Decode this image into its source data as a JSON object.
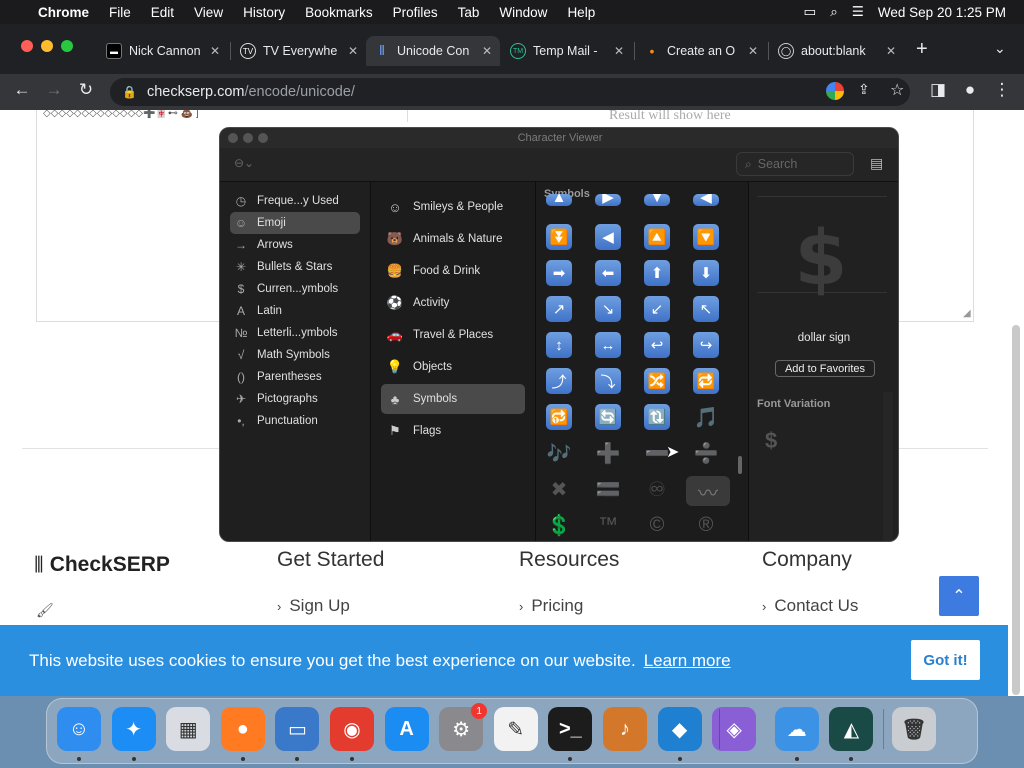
{
  "menubar": {
    "app": "Chrome",
    "items": [
      "File",
      "Edit",
      "View",
      "History",
      "Bookmarks",
      "Profiles",
      "Tab",
      "Window",
      "Help"
    ],
    "datetime": "Wed Sep 20  1:25 PM"
  },
  "tabs": [
    {
      "label": "Nick Cannon",
      "icon": "tab-favicon-nick"
    },
    {
      "label": "TV Everywhe",
      "icon": "tv-icon"
    },
    {
      "label": "Unicode Con",
      "icon": "checkserp-favicon",
      "active": true
    },
    {
      "label": "Temp Mail -",
      "icon": "tempmail-icon"
    },
    {
      "label": "Create an O",
      "icon": "dot-favicon"
    },
    {
      "label": "about:blank",
      "icon": "globe-icon"
    }
  ],
  "address": {
    "host": "checkserp.com",
    "path": "/encode/unicode/"
  },
  "page": {
    "input_preview": "◇◇◇◇◇◇◇◇◇◇◇◇◇➕🀄⊷ 💩 ]",
    "result_placeholder": "Result will show here",
    "footer": {
      "brand": "CheckSERP",
      "columns": [
        {
          "heading": "Get Started",
          "link": "Sign Up"
        },
        {
          "heading": "Resources",
          "link": "Pricing"
        },
        {
          "heading": "Company",
          "link": "Contact Us"
        }
      ]
    },
    "cookie": {
      "text": "This website uses cookies to ensure you get the best experience on our website.",
      "link": "Learn more",
      "button": "Got it!"
    },
    "scroll_top": "⌃"
  },
  "character_viewer": {
    "title": "Character Viewer",
    "search_placeholder": "Search",
    "categories": [
      {
        "label": "Freque...y Used",
        "icon": "◷"
      },
      {
        "label": "Emoji",
        "icon": "☺",
        "selected": true
      },
      {
        "label": "Arrows",
        "icon": "→"
      },
      {
        "label": "Bullets & Stars",
        "icon": "✳"
      },
      {
        "label": "Curren...ymbols",
        "icon": "$"
      },
      {
        "label": "Latin",
        "icon": "A"
      },
      {
        "label": "Letterli...ymbols",
        "icon": "№"
      },
      {
        "label": "Math Symbols",
        "icon": "√"
      },
      {
        "label": "Parentheses",
        "icon": "()"
      },
      {
        "label": "Pictographs",
        "icon": "✈"
      },
      {
        "label": "Punctuation",
        "icon": "•,"
      }
    ],
    "subcategories": [
      {
        "label": "Smileys & People",
        "icon": "☺"
      },
      {
        "label": "Animals & Nature",
        "icon": "🐻"
      },
      {
        "label": "Food & Drink",
        "icon": "🍔"
      },
      {
        "label": "Activity",
        "icon": "⚽"
      },
      {
        "label": "Travel & Places",
        "icon": "🚗"
      },
      {
        "label": "Objects",
        "icon": "💡"
      },
      {
        "label": "Symbols",
        "icon": "♣",
        "selected": true
      },
      {
        "label": "Flags",
        "icon": "⚑"
      }
    ],
    "grid_label": "Symbols",
    "grid": [
      [
        "▲",
        "▶",
        "▼",
        "◀"
      ],
      [
        "⏬",
        "◀",
        "🔼",
        "🔽"
      ],
      [
        "➡",
        "⬅",
        "⬆",
        "⬇"
      ],
      [
        "↗",
        "↘",
        "↙",
        "↖"
      ],
      [
        "↕",
        "↔",
        "↩",
        "↪"
      ],
      [
        "⤴",
        "⤵",
        "🔀",
        "🔁"
      ],
      [
        "🔂",
        "🔄",
        "🔃",
        "🎵"
      ],
      [
        "🎶",
        "➕",
        "➖",
        "➗"
      ],
      [
        "✖",
        "🟰",
        "♾",
        "〰"
      ],
      [
        "💲",
        "™",
        "©",
        "®"
      ]
    ],
    "selected_name": "dollar sign",
    "selected_glyph": "$",
    "add_favorites": "Add to Favorites",
    "font_variation_label": "Font Variation"
  },
  "dock": [
    {
      "name": "finder-icon",
      "color": "#2f8df0",
      "glyph": "☺"
    },
    {
      "name": "safari-icon",
      "color": "#1c8df5",
      "glyph": "✦"
    },
    {
      "name": "launchpad-icon",
      "color": "#d9dde3",
      "glyph": "▦"
    },
    {
      "name": "firefox-icon",
      "color": "#ff7a20",
      "glyph": "●"
    },
    {
      "name": "screen-sharing-icon",
      "color": "#3a78c9",
      "glyph": "▭"
    },
    {
      "name": "chrome-icon",
      "color": "#e33b2e",
      "glyph": "◉"
    },
    {
      "name": "app-store-icon",
      "color": "#1b8cf1",
      "glyph": "A"
    },
    {
      "name": "system-settings-icon",
      "color": "#8a8a8e",
      "glyph": "⚙",
      "badge": "1"
    },
    {
      "name": "textedit-icon",
      "color": "#f2f2f2",
      "glyph": "✎"
    },
    {
      "name": "terminal-icon",
      "color": "#1c1c1c",
      "glyph": ">_"
    },
    {
      "name": "garageband-icon",
      "color": "#d3782a",
      "glyph": "♪"
    },
    {
      "name": "vscode-icon",
      "color": "#1f7fd0",
      "glyph": "◆"
    },
    {
      "name": "visual-studio-icon",
      "color": "#8a5fd6",
      "glyph": "◈"
    },
    {
      "name": "weather-icon",
      "color": "#3c93e6",
      "glyph": "☁"
    },
    {
      "name": "filmora-icon",
      "color": "#1a4a46",
      "glyph": "◭"
    },
    {
      "name": "trash-icon",
      "color": "#c9ccd1",
      "glyph": "🗑"
    }
  ]
}
